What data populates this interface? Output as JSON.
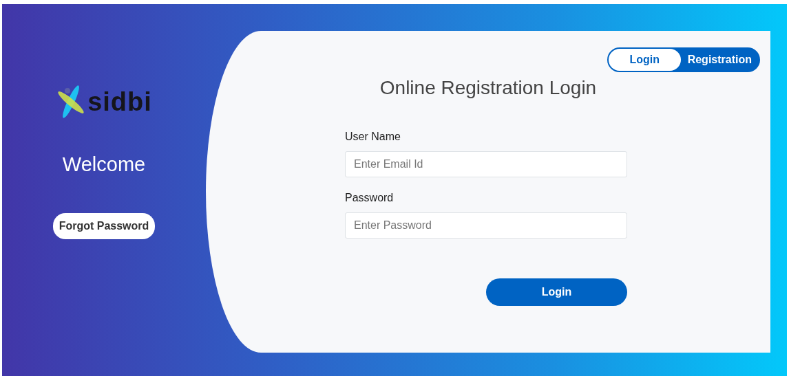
{
  "brand": {
    "logo_text": "sidbi"
  },
  "welcome": "Welcome",
  "forgot_password": "Forgot Password",
  "toggle": [
    {
      "label": "Login",
      "selected": true
    },
    {
      "label": "Registration",
      "selected": false
    }
  ],
  "title": "Online Registration Login",
  "fields": [
    {
      "label": "User Name",
      "placeholder": "Enter Email Id"
    },
    {
      "label": "Password",
      "placeholder": "Enter Password"
    }
  ],
  "submit": "Login"
}
